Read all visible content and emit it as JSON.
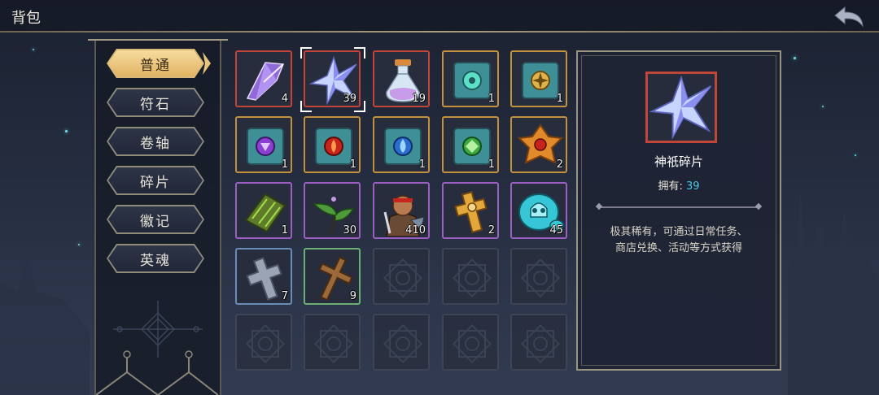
{
  "header": {
    "title": "背包",
    "back_icon": "back-arrow-icon"
  },
  "tabs": [
    {
      "label": "普通",
      "active": true
    },
    {
      "label": "符石",
      "active": false
    },
    {
      "label": "卷轴",
      "active": false
    },
    {
      "label": "碎片",
      "active": false
    },
    {
      "label": "徽记",
      "active": false
    },
    {
      "label": "英魂",
      "active": false
    }
  ],
  "inventory": {
    "rows": [
      [
        {
          "icon": "purple-crystal-icon",
          "quality": "red",
          "qty": "4"
        },
        {
          "icon": "star-shard-icon",
          "quality": "red",
          "qty": "39",
          "selected": true
        },
        {
          "icon": "potion-bottle-icon",
          "quality": "red",
          "qty": "19"
        },
        {
          "icon": "teal-rune-scroll-icon",
          "quality": "gold",
          "qty": "1"
        },
        {
          "icon": "gold-rune-scroll-icon",
          "quality": "gold",
          "qty": "1"
        }
      ],
      [
        {
          "icon": "purple-rune-scroll-icon",
          "quality": "gold",
          "qty": "1"
        },
        {
          "icon": "fire-rune-scroll-icon",
          "quality": "gold",
          "qty": "1"
        },
        {
          "icon": "water-rune-scroll-icon",
          "quality": "gold",
          "qty": "1"
        },
        {
          "icon": "leaf-rune-scroll-icon",
          "quality": "gold",
          "qty": "1"
        },
        {
          "icon": "orange-emblem-icon",
          "quality": "gold",
          "qty": "2"
        }
      ],
      [
        {
          "icon": "green-wood-icon",
          "quality": "purple",
          "qty": "1"
        },
        {
          "icon": "green-leaf-icon",
          "quality": "purple",
          "qty": "30"
        },
        {
          "icon": "warrior-portrait-icon",
          "quality": "purple",
          "qty": "410"
        },
        {
          "icon": "golden-cross-icon",
          "quality": "purple",
          "qty": "2"
        },
        {
          "icon": "cyan-skull-coin-icon",
          "quality": "purple",
          "qty": "45"
        }
      ],
      [
        {
          "icon": "stone-cross-icon",
          "quality": "blue",
          "qty": "7"
        },
        {
          "icon": "wooden-cross-icon",
          "quality": "green",
          "qty": "9"
        },
        {
          "icon": "empty-slot-icon",
          "quality": "empty",
          "qty": ""
        },
        {
          "icon": "empty-slot-icon",
          "quality": "empty",
          "qty": ""
        },
        {
          "icon": "empty-slot-icon",
          "quality": "empty",
          "qty": ""
        }
      ],
      [
        {
          "icon": "empty-slot-icon",
          "quality": "empty",
          "qty": ""
        },
        {
          "icon": "empty-slot-icon",
          "quality": "empty",
          "qty": ""
        },
        {
          "icon": "empty-slot-icon",
          "quality": "empty",
          "qty": ""
        },
        {
          "icon": "empty-slot-icon",
          "quality": "empty",
          "qty": ""
        },
        {
          "icon": "empty-slot-icon",
          "quality": "empty",
          "qty": ""
        }
      ]
    ]
  },
  "detail": {
    "icon": "star-shard-icon",
    "name": "神祇碎片",
    "owned_label": "拥有:",
    "owned_value": "39",
    "description_line1": "极其稀有，可通过日常任务、",
    "description_line2": "商店兑换、活动等方式获得"
  },
  "colors": {
    "quality_red": "#c2453a",
    "quality_gold": "#c1913d",
    "quality_purple": "#9a5fc0",
    "quality_blue": "#6a8cb8",
    "quality_green": "#6bb072",
    "owned_value": "#4bc6e6",
    "active_tab": "#e0b363"
  }
}
